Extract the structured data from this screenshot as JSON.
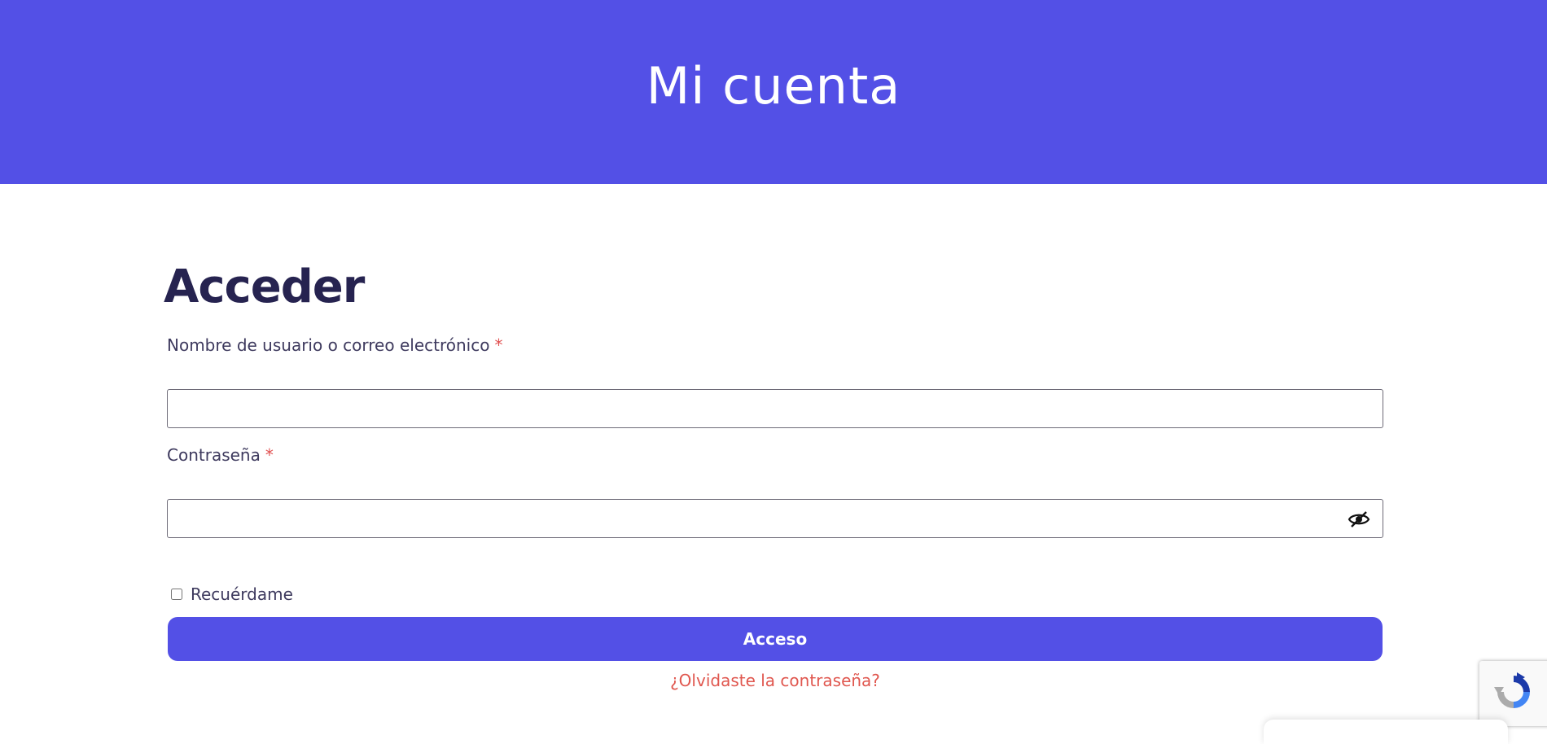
{
  "header": {
    "title": "Mi cuenta"
  },
  "login": {
    "title": "Acceder",
    "username": {
      "label": "Nombre de usuario o correo electrónico",
      "required_mark": "*",
      "value": ""
    },
    "password": {
      "label": "Contraseña",
      "required_mark": "*",
      "value": "",
      "toggle_icon": "eye-slash-icon"
    },
    "remember": {
      "label": "Recuérdame",
      "checked": false
    },
    "submit_label": "Acceso",
    "forgot_label": "¿Olvidaste la contraseña?"
  },
  "recaptcha": {
    "icon": "recaptcha-icon"
  },
  "colors": {
    "brand": "#5350e6",
    "heading": "#262350",
    "required": "#e05050",
    "link": "#e0574f"
  }
}
